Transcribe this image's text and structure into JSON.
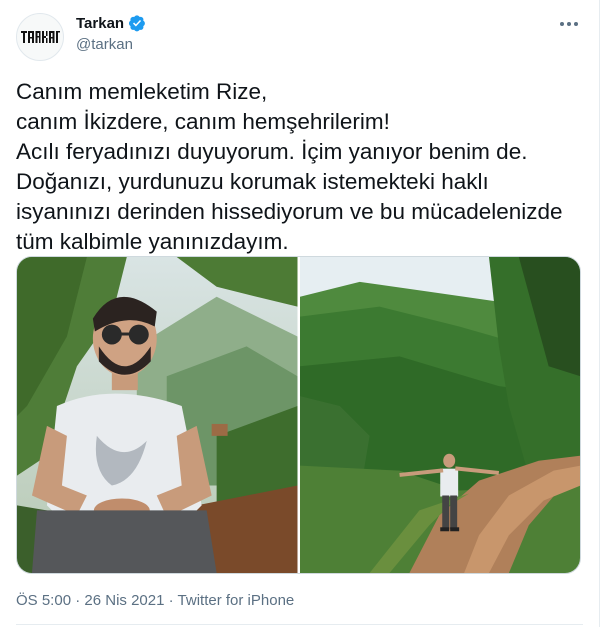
{
  "author": {
    "display_name": "Tarkan",
    "handle": "@tarkan",
    "avatar_logo": "TARKAN",
    "verified": true
  },
  "tweet": {
    "lines": [
      "Canım memleketim Rize,",
      "canım İkizdere, canım hemşehrilerim!",
      "Acılı feryadınızı duyuyorum. İçim yanıyor benim de.",
      "Doğanızı, yurdunuzu korumak istemekteki haklı",
      "isyanınızı derinden hissediyorum ve bu mücadelenizde",
      "tüm kalbimle yanınızdayım."
    ]
  },
  "media": {
    "photos": [
      {
        "subject": "man-sitting-portrait"
      },
      {
        "subject": "man-on-mountain-road"
      }
    ]
  },
  "meta": {
    "time": "ÖS 5:00",
    "separator": "·",
    "date": "26 Nis 2021",
    "source": "Twitter for iPhone"
  },
  "icons": {
    "verified": "verified-badge-icon",
    "more": "more-options-icon"
  },
  "colors": {
    "verified_blue": "#1d9bf0",
    "secondary_text": "#5b7083",
    "primary_text": "#0f1419"
  }
}
